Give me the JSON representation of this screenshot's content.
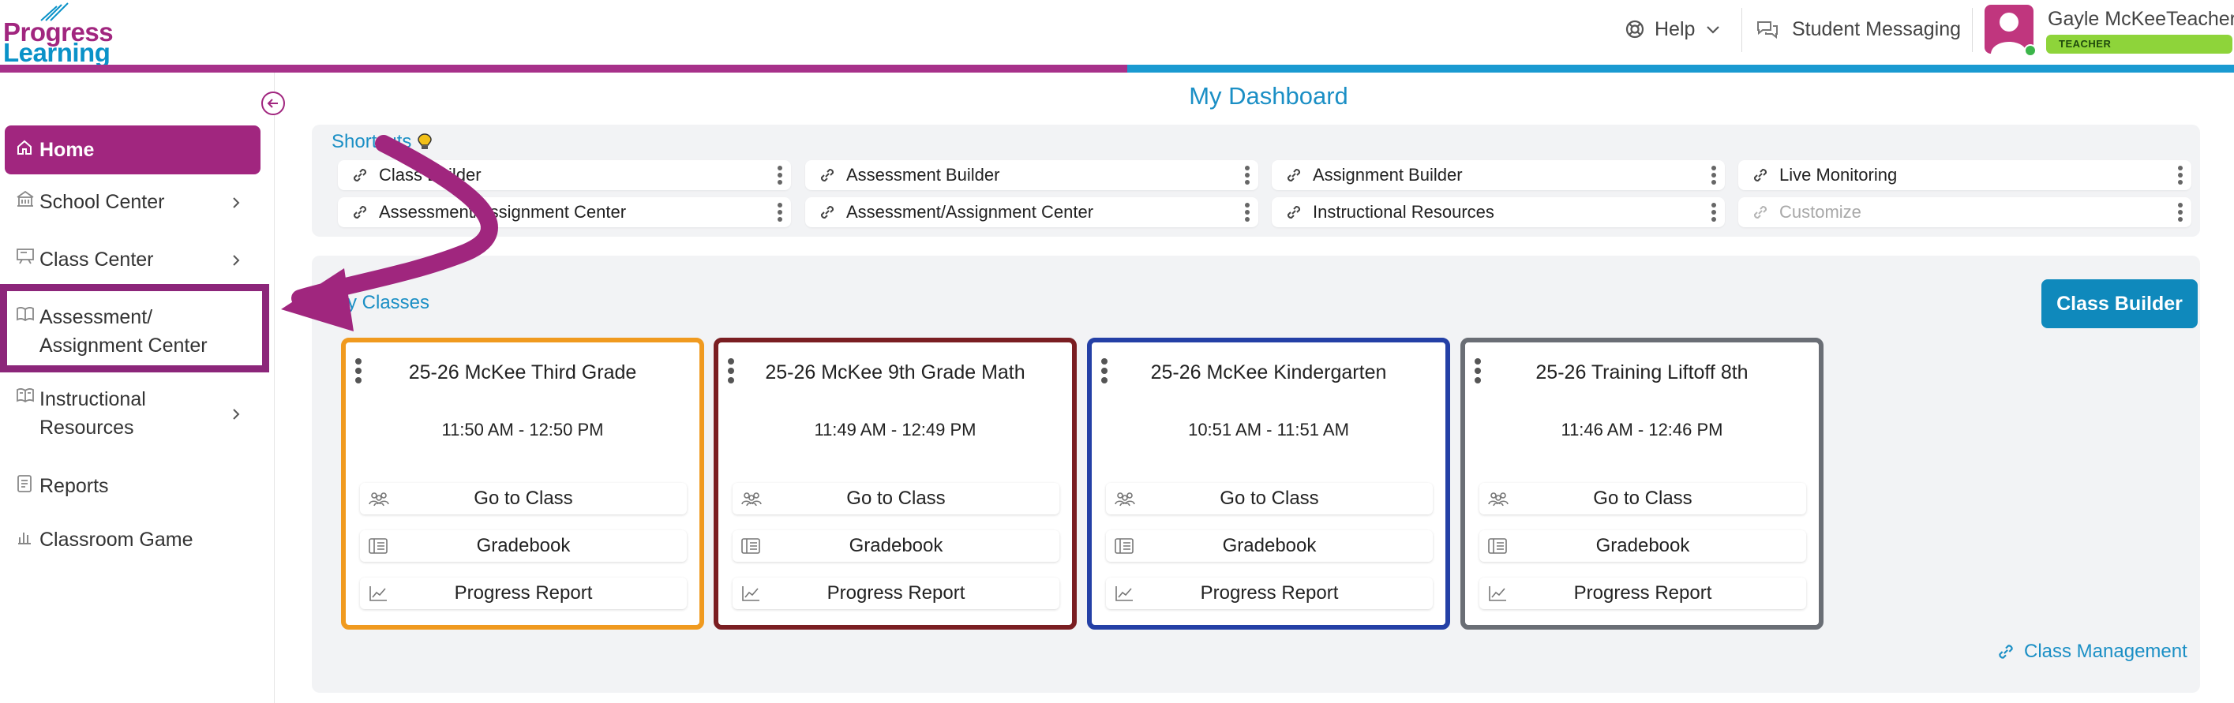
{
  "brand": {
    "line1": "Progress",
    "line2": "Learning"
  },
  "header": {
    "help_label": "Help",
    "messaging_label": "Student Messaging",
    "user_name": "Gayle McKeeTeacher",
    "user_role": "TEACHER"
  },
  "colors": {
    "brand_purple": "#a1267f",
    "brand_blue": "#1a9ad1",
    "highlight_border": "#8c267a",
    "card_borders": [
      "#f09a1f",
      "#7a1e22",
      "#2440a6",
      "#6a6e75"
    ]
  },
  "sidebar": {
    "items": [
      {
        "label": "Home",
        "icon": "home-icon",
        "active": true,
        "chevron": false
      },
      {
        "label": "School Center",
        "icon": "school-icon",
        "active": false,
        "chevron": true
      },
      {
        "label": "Class Center",
        "icon": "class-icon",
        "active": false,
        "chevron": true
      },
      {
        "label_line1": "Assessment/",
        "label_line2": "Assignment Center",
        "icon": "book-icon",
        "active": false,
        "chevron": false
      },
      {
        "label_line1": "Instructional",
        "label_line2": "Resources",
        "icon": "resources-icon",
        "active": false,
        "chevron": true
      },
      {
        "label": "Reports",
        "icon": "reports-icon",
        "active": false,
        "chevron": false
      },
      {
        "label": "Classroom Game",
        "icon": "game-icon",
        "active": false,
        "chevron": false
      }
    ]
  },
  "main": {
    "title": "My Dashboard",
    "shortcuts": {
      "title": "Shortcuts",
      "items": [
        {
          "label": "Class Builder"
        },
        {
          "label": "Assessment Builder"
        },
        {
          "label": "Assignment Builder"
        },
        {
          "label": "Live Monitoring"
        },
        {
          "label": "Assessment/Assignment Center"
        },
        {
          "label": "Assessment/Assignment Center"
        },
        {
          "label": "Instructional Resources"
        },
        {
          "label": "Customize"
        }
      ]
    },
    "classes": {
      "title": "My Classes",
      "builder_button": "Class Builder",
      "cards": [
        {
          "name": "25-26 McKee Third Grade",
          "time": "11:50 AM - 12:50 PM"
        },
        {
          "name": "25-26 McKee 9th Grade Math",
          "time": "11:49 AM - 12:49 PM"
        },
        {
          "name": "25-26 McKee Kindergarten",
          "time": "10:51 AM - 11:51 AM"
        },
        {
          "name": "25-26 Training Liftoff 8th",
          "time": "11:46 AM - 12:46 PM"
        }
      ],
      "actions": {
        "go_to_class": "Go to Class",
        "gradebook": "Gradebook",
        "progress_report": "Progress Report"
      },
      "management_link": "Class Management"
    }
  }
}
